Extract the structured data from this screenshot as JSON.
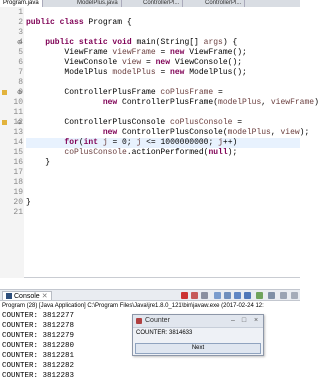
{
  "editor_tabs": [
    "Program.java",
    "ModelPlus.java",
    "ControllerPl...",
    "ControllerPl..."
  ],
  "code": {
    "line_numbers": [
      "1",
      "2",
      "3",
      "4",
      "5",
      "6",
      "7",
      "8",
      "9",
      "10",
      "11",
      "12",
      "13",
      "14",
      "15",
      "16",
      "17",
      "18",
      "19",
      "20",
      "21"
    ],
    "lines": [
      [],
      [
        [
          "kw",
          "public "
        ],
        [
          "kw",
          "class "
        ],
        [
          "",
          "Program {"
        ]
      ],
      [],
      [
        [
          "",
          "    "
        ],
        [
          "kw",
          "public "
        ],
        [
          "kw",
          "static "
        ],
        [
          "kw",
          "void "
        ],
        [
          "",
          "main(String[] "
        ],
        [
          "var",
          "args"
        ],
        [
          "",
          ") {"
        ]
      ],
      [
        [
          "",
          "        ViewFrame "
        ],
        [
          "var",
          "viewFrame"
        ],
        [
          "",
          " = "
        ],
        [
          "kw",
          "new "
        ],
        [
          "",
          "ViewFrame();"
        ]
      ],
      [
        [
          "",
          "        ViewConsole "
        ],
        [
          "var",
          "view"
        ],
        [
          "",
          " = "
        ],
        [
          "kw",
          "new "
        ],
        [
          "",
          "ViewConsole();"
        ]
      ],
      [
        [
          "",
          "        ModelPlus "
        ],
        [
          "var",
          "modelPlus"
        ],
        [
          "",
          " = "
        ],
        [
          "kw",
          "new "
        ],
        [
          "",
          "ModelPlus();"
        ]
      ],
      [],
      [
        [
          "",
          "        ControllerPlusFrame "
        ],
        [
          "var",
          "coPlusFrame"
        ],
        [
          "",
          " ="
        ]
      ],
      [
        [
          "",
          "                "
        ],
        [
          "kw",
          "new "
        ],
        [
          "",
          "ControllerPlusFrame("
        ],
        [
          "var",
          "modelPlus"
        ],
        [
          "",
          ", "
        ],
        [
          "var",
          "viewFrame"
        ],
        [
          "",
          ");"
        ]
      ],
      [],
      [
        [
          "",
          "        ControllerPlusConsole "
        ],
        [
          "var",
          "coPlusConsole"
        ],
        [
          "",
          " ="
        ]
      ],
      [
        [
          "",
          "                "
        ],
        [
          "kw",
          "new "
        ],
        [
          "",
          "ControllerPlusConsole("
        ],
        [
          "var",
          "modelPlus"
        ],
        [
          "",
          ", "
        ],
        [
          "var",
          "view"
        ],
        [
          "",
          ");"
        ]
      ],
      [
        [
          "",
          "        "
        ],
        [
          "kw",
          "for"
        ],
        [
          "",
          "("
        ],
        [
          "kw",
          "int "
        ],
        [
          "var",
          "j"
        ],
        [
          "",
          " = 0; "
        ],
        [
          "var",
          "j"
        ],
        [
          "",
          " <= 1000000000; "
        ],
        [
          "var",
          "j"
        ],
        [
          "",
          "++)"
        ]
      ],
      [
        [
          "",
          "        "
        ],
        [
          "var",
          "coPlusConsole"
        ],
        [
          "",
          ".actionPerformed("
        ],
        [
          "kw",
          "null"
        ],
        [
          "",
          ");"
        ]
      ],
      [
        [
          "",
          "    }"
        ]
      ],
      [],
      [],
      [],
      [
        [
          "",
          "}"
        ]
      ],
      []
    ]
  },
  "console": {
    "tab_label": "Console",
    "header": "Program (28) [Java Application] C:\\Program Files\\Java\\jre1.8.0_121\\bin\\javaw.exe (2017-02-24 12:",
    "output": [
      "COUNTER: 3812277",
      "COUNTER: 3812278",
      "COUNTER: 3812279",
      "COUNTER: 3812280",
      "COUNTER: 3812281",
      "COUNTER: 3812282",
      "COUNTER: 3812283"
    ]
  },
  "counter_window": {
    "title": "Counter",
    "text": "COUNTER: 3814633",
    "button": "Next",
    "minimize": "–",
    "maximize": "□",
    "close": "×"
  }
}
